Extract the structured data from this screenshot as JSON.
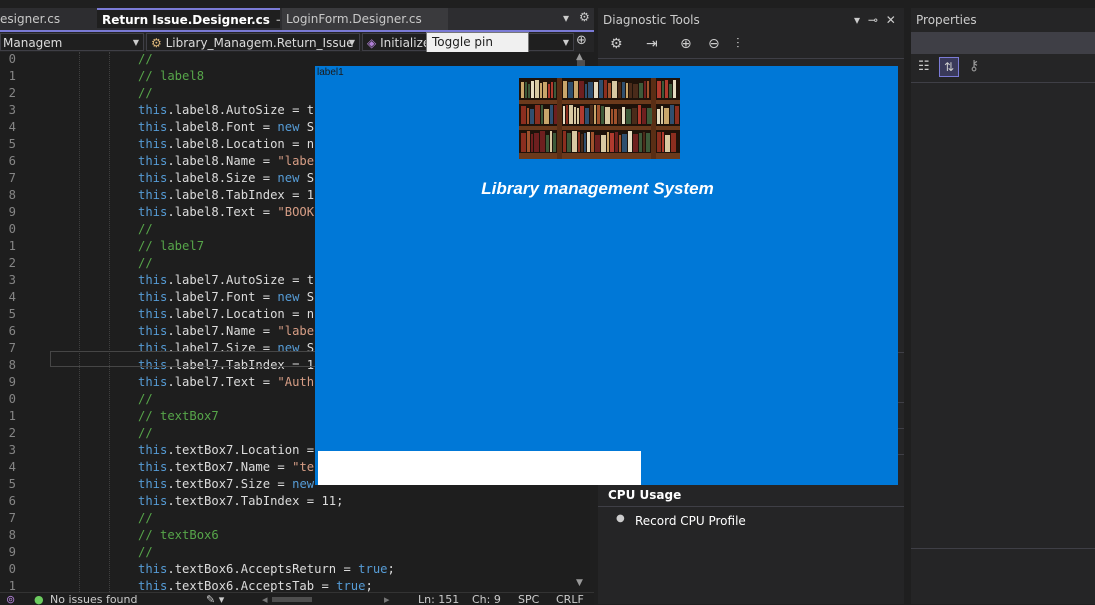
{
  "tabs": [
    {
      "label": "esigner.cs",
      "glyph": "",
      "active": false
    },
    {
      "label": "Return Issue.Designer.cs",
      "glyph": "⊸ ✕",
      "active": true
    },
    {
      "label": "LoginForm.Designer.cs",
      "glyph": "",
      "active": false
    }
  ],
  "tab_overflow_icon": "▾",
  "tab_settings_icon": "⚙",
  "nav": {
    "project": "Managem",
    "class_combo": "Library_Managem.Return_Issue",
    "member_combo": "Initialize",
    "tooltip": "Toggle pin status"
  },
  "code_lines": [
    {
      "n": "0",
      "segs": [
        {
          "t": "//",
          "c": "cm"
        }
      ]
    },
    {
      "n": "1",
      "segs": [
        {
          "t": "// label8",
          "c": "cm"
        }
      ]
    },
    {
      "n": "2",
      "segs": [
        {
          "t": "//",
          "c": "cm"
        }
      ]
    },
    {
      "n": "3",
      "segs": [
        {
          "t": "this",
          "c": "kw"
        },
        {
          "t": ".label8.AutoSize = t",
          "c": ""
        }
      ]
    },
    {
      "n": "4",
      "segs": [
        {
          "t": "this",
          "c": "kw"
        },
        {
          "t": ".label8.Font = ",
          "c": ""
        },
        {
          "t": "new",
          "c": "kw"
        },
        {
          "t": " S",
          "c": ""
        }
      ]
    },
    {
      "n": "5",
      "segs": [
        {
          "t": "this",
          "c": "kw"
        },
        {
          "t": ".label8.Location = n",
          "c": ""
        }
      ]
    },
    {
      "n": "6",
      "segs": [
        {
          "t": "this",
          "c": "kw"
        },
        {
          "t": ".label8.Name = ",
          "c": ""
        },
        {
          "t": "\"labe",
          "c": "st"
        }
      ]
    },
    {
      "n": "7",
      "segs": [
        {
          "t": "this",
          "c": "kw"
        },
        {
          "t": ".label8.Size = ",
          "c": ""
        },
        {
          "t": "new",
          "c": "kw"
        },
        {
          "t": " S",
          "c": ""
        }
      ]
    },
    {
      "n": "8",
      "segs": [
        {
          "t": "this",
          "c": "kw"
        },
        {
          "t": ".label8.TabIndex = 1",
          "c": ""
        }
      ]
    },
    {
      "n": "9",
      "segs": [
        {
          "t": "this",
          "c": "kw"
        },
        {
          "t": ".label8.Text = ",
          "c": ""
        },
        {
          "t": "\"BOOK",
          "c": "st"
        }
      ]
    },
    {
      "n": "0",
      "segs": [
        {
          "t": "//",
          "c": "cm"
        }
      ]
    },
    {
      "n": "1",
      "segs": [
        {
          "t": "// label7",
          "c": "cm"
        }
      ]
    },
    {
      "n": "2",
      "segs": [
        {
          "t": "//",
          "c": "cm"
        }
      ]
    },
    {
      "n": "3",
      "segs": [
        {
          "t": "this",
          "c": "kw"
        },
        {
          "t": ".label7.AutoSize = t",
          "c": ""
        }
      ]
    },
    {
      "n": "4",
      "segs": [
        {
          "t": "this",
          "c": "kw"
        },
        {
          "t": ".label7.Font = ",
          "c": ""
        },
        {
          "t": "new",
          "c": "kw"
        },
        {
          "t": " S",
          "c": ""
        }
      ]
    },
    {
      "n": "5",
      "segs": [
        {
          "t": "this",
          "c": "kw"
        },
        {
          "t": ".label7.Location = n",
          "c": ""
        }
      ]
    },
    {
      "n": "6",
      "segs": [
        {
          "t": "this",
          "c": "kw"
        },
        {
          "t": ".label7.Name = ",
          "c": ""
        },
        {
          "t": "\"labe",
          "c": "st"
        }
      ]
    },
    {
      "n": "7",
      "segs": [
        {
          "t": "this",
          "c": "kw"
        },
        {
          "t": ".label7.Size = ",
          "c": ""
        },
        {
          "t": "new",
          "c": "kw"
        },
        {
          "t": " S",
          "c": ""
        }
      ]
    },
    {
      "n": "8",
      "segs": [
        {
          "t": "this",
          "c": "kw"
        },
        {
          "t": ".label7.TabIndex = 1",
          "c": ""
        }
      ]
    },
    {
      "n": "9",
      "segs": [
        {
          "t": "this",
          "c": "kw"
        },
        {
          "t": ".label7.Text = ",
          "c": ""
        },
        {
          "t": "\"Auth",
          "c": "st"
        }
      ]
    },
    {
      "n": "0",
      "segs": [
        {
          "t": "//",
          "c": "cm"
        }
      ]
    },
    {
      "n": "1",
      "segs": [
        {
          "t": "// textBox7",
          "c": "cm"
        }
      ]
    },
    {
      "n": "2",
      "segs": [
        {
          "t": "//",
          "c": "cm"
        }
      ]
    },
    {
      "n": "3",
      "segs": [
        {
          "t": "this",
          "c": "kw"
        },
        {
          "t": ".textBox7.Location = ",
          "c": ""
        }
      ]
    },
    {
      "n": "4",
      "segs": [
        {
          "t": "this",
          "c": "kw"
        },
        {
          "t": ".textBox7.Name = ",
          "c": ""
        },
        {
          "t": "\"te",
          "c": "st"
        }
      ]
    },
    {
      "n": "5",
      "segs": [
        {
          "t": "this",
          "c": "kw"
        },
        {
          "t": ".textBox7.Size = ",
          "c": ""
        },
        {
          "t": "new",
          "c": "kw"
        }
      ]
    },
    {
      "n": "6",
      "segs": [
        {
          "t": "this",
          "c": "kw"
        },
        {
          "t": ".textBox7.TabIndex = 11;",
          "c": ""
        }
      ]
    },
    {
      "n": "7",
      "segs": [
        {
          "t": "//",
          "c": "cm"
        }
      ]
    },
    {
      "n": "8",
      "segs": [
        {
          "t": "// textBox6",
          "c": "cm"
        }
      ]
    },
    {
      "n": "9",
      "segs": [
        {
          "t": "//",
          "c": "cm"
        }
      ]
    },
    {
      "n": "0",
      "segs": [
        {
          "t": "this",
          "c": "kw"
        },
        {
          "t": ".textBox6.AcceptsReturn = ",
          "c": ""
        },
        {
          "t": "true",
          "c": "kw"
        },
        {
          "t": ";",
          "c": ""
        }
      ]
    },
    {
      "n": "1",
      "segs": [
        {
          "t": "this",
          "c": "kw"
        },
        {
          "t": ".textBox6.AcceptsTab = ",
          "c": ""
        },
        {
          "t": "true",
          "c": "kw"
        },
        {
          "t": ";",
          "c": ""
        }
      ]
    }
  ],
  "status": {
    "issues": "No issues found",
    "line": "Ln: 151",
    "col": "Ch: 9",
    "spc": "SPC",
    "crlf": "CRLF"
  },
  "diag": {
    "title": "Diagnostic Tools",
    "title_icons": "▾ ⊸ ✕",
    "cpu_usage": "CPU Usage",
    "record_cpu": "Record CPU Profile"
  },
  "props": {
    "title": "Properties"
  },
  "app": {
    "label1": "label1",
    "title": "Library management System"
  },
  "colors": {
    "app_background": "#0078d7",
    "accent": "#7b7bd6",
    "keyword": "#569cd6",
    "comment": "#57a64a",
    "string": "#d69d85"
  }
}
